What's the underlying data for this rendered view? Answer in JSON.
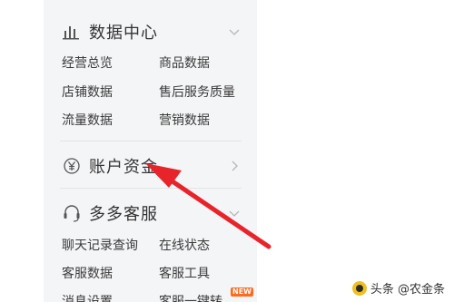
{
  "sidebar": {
    "sections": [
      {
        "title": "数据中心",
        "icon": "bar-chart-icon",
        "items": [
          "经营总览",
          "商品数据",
          "店铺数据",
          "售后服务质量",
          "流量数据",
          "营销数据"
        ]
      },
      {
        "title": "账户资金",
        "icon": "yen-icon"
      },
      {
        "title": "多多客服",
        "icon": "headset-icon",
        "items": [
          "聊天记录查询",
          "在线状态",
          "客服数据",
          "客服工具",
          "消息设置",
          "客服一键转"
        ],
        "badge": "NEW"
      }
    ]
  },
  "watermark": {
    "text": "头条 @农金条"
  },
  "colors": {
    "arrow": "#e8242b",
    "badge": "#ff6a1f",
    "sidebar_bg": "#f4f5f7"
  }
}
